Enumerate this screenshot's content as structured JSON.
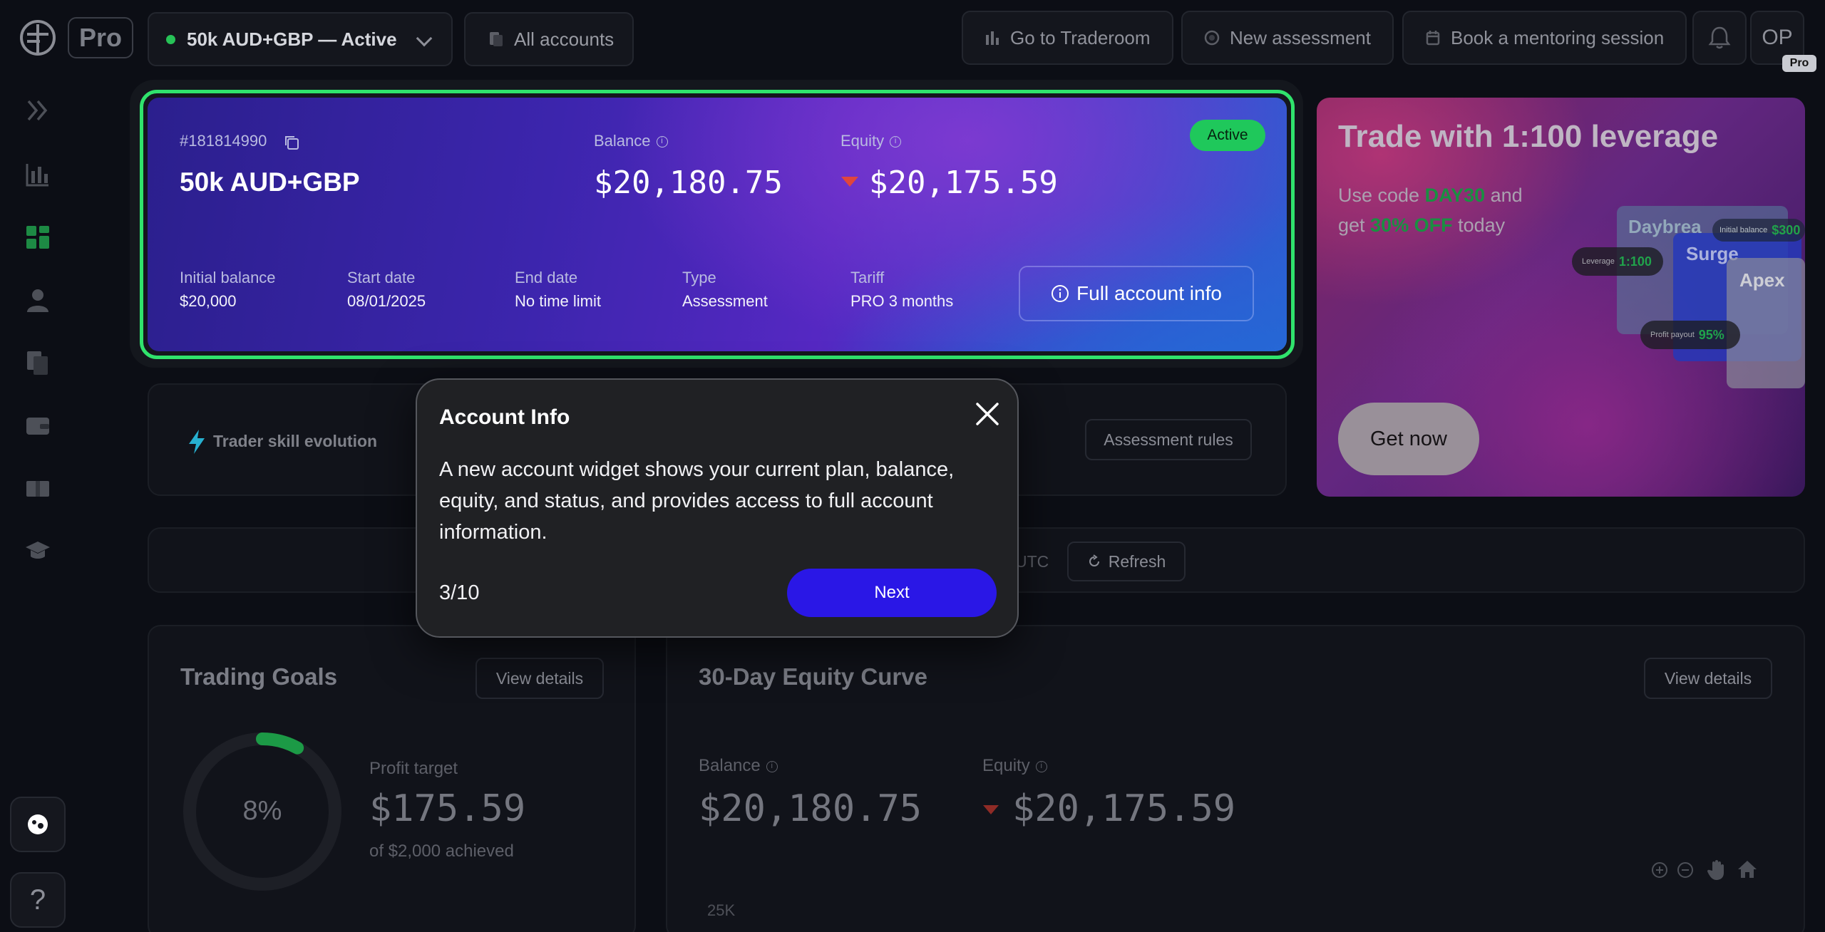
{
  "topbar": {
    "brand_badge": "Pro",
    "account_selector": "50k AUD+GBP — Active",
    "all_accounts": "All accounts",
    "go_to_traderoom": "Go to Traderoom",
    "new_assessment": "New assessment",
    "book_mentoring": "Book a mentoring session",
    "user_initials": "OP",
    "user_badge": "Pro"
  },
  "account_card": {
    "id": "#181814990",
    "name": "50k AUD+GBP",
    "balance_label": "Balance",
    "balance": "$20,180.75",
    "equity_label": "Equity",
    "equity": "$20,175.59",
    "status": "Active",
    "initial_balance_label": "Initial balance",
    "initial_balance": "$20,000",
    "start_date_label": "Start date",
    "start_date": "08/01/2025",
    "end_date_label": "End date",
    "end_date": "No time limit",
    "type_label": "Type",
    "type": "Assessment",
    "tariff_label": "Tariff",
    "tariff": "PRO 3 months",
    "full_info_button": "Full account info"
  },
  "promo": {
    "title": "Trade with 1:100 leverage",
    "text_prefix": "Use code ",
    "code": "DAY30",
    "text_mid": " and",
    "text_line2_prefix": "get ",
    "discount": "30% OFF",
    "text_suffix": " today",
    "tile1": "Daybrea",
    "tile2": "Surge",
    "tile3": "Apex",
    "initial_balance_chip": "Initial balance",
    "initial_balance_value": "$300",
    "leverage_chip": "Leverage",
    "leverage_value": "1:100",
    "profit_payout_chip": "Profit payout",
    "profit_payout_value": "95%",
    "button": "Get now"
  },
  "skill_bar": {
    "label": "Trader skill evolution",
    "rules_button": "Assessment rules"
  },
  "refresh_bar": {
    "utc_label": "UTC",
    "refresh_button": "Refresh"
  },
  "trading_goals": {
    "title": "Trading Goals",
    "view_details": "View details",
    "progress_percent": "8%",
    "progress_fraction": 0.08,
    "profit_target_label": "Profit target",
    "profit_value": "$175.59",
    "achieved_text": "of $2,000 achieved"
  },
  "equity_curve": {
    "title": "30-Day Equity Curve",
    "view_details": "View details",
    "balance_label": "Balance",
    "balance": "$20,180.75",
    "equity_label": "Equity",
    "equity": "$20,175.59",
    "y_tick": "25K"
  },
  "modal": {
    "title": "Account Info",
    "body": "A new account widget shows your current plan, balance, equity, and status, and provides access to full account information.",
    "step": "3/10",
    "next_button": "Next"
  },
  "sidebar": {
    "help": "?"
  },
  "colors": {
    "accent_green": "#30e36c",
    "next_blue": "#2a17e6",
    "down_red": "#e0463c"
  }
}
